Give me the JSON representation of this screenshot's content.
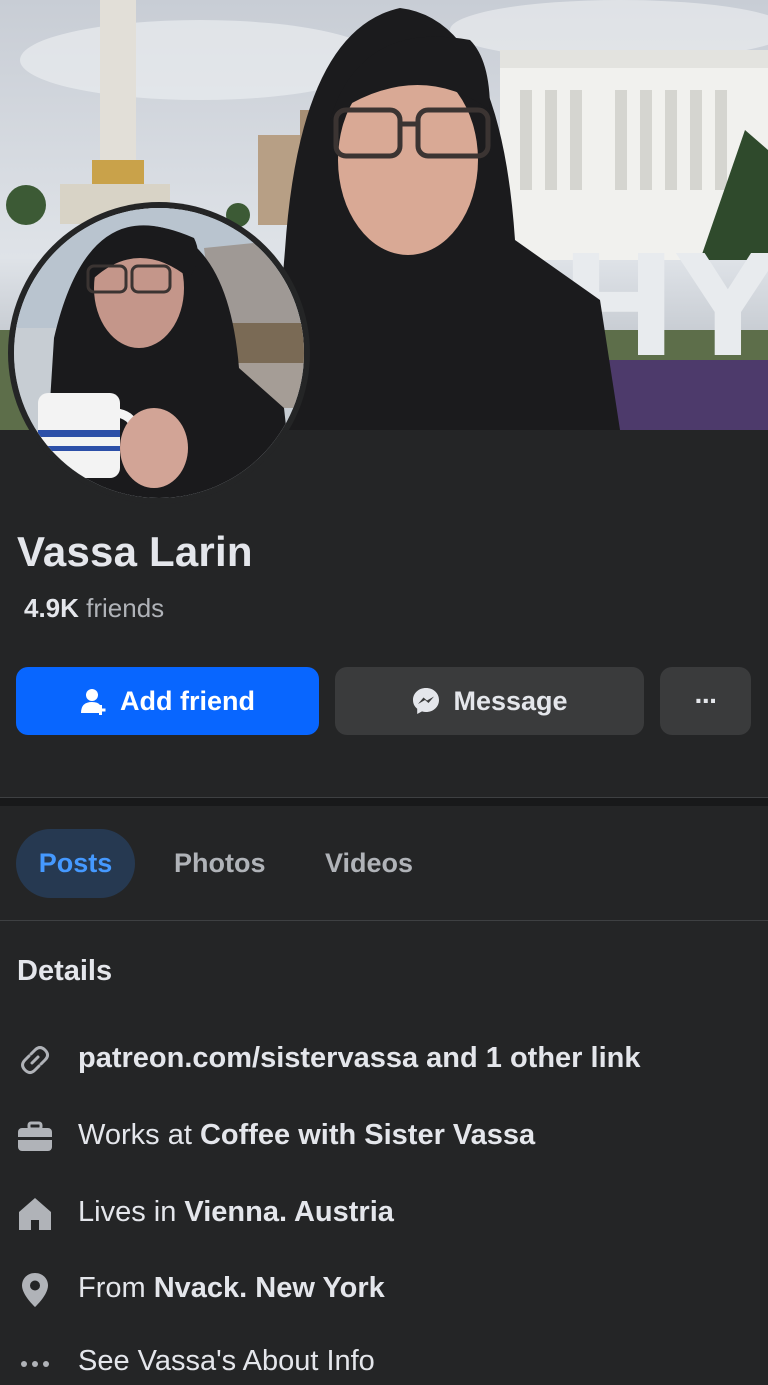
{
  "profile": {
    "name": "Vassa Larin",
    "friends_count": "4.9K",
    "friends_label": " friends"
  },
  "actions": {
    "add_friend": "Add friend",
    "message": "Message",
    "more": "···"
  },
  "tabs": [
    {
      "label": "Posts",
      "active": true
    },
    {
      "label": "Photos",
      "active": false
    },
    {
      "label": "Videos",
      "active": false
    }
  ],
  "details": {
    "title": "Details",
    "link": "patreon.com/sistervassa and 1 other link",
    "work_prefix": "Works at ",
    "work_value": "Coffee with Sister Vassa",
    "lives_prefix": "Lives in ",
    "lives_value": "Vienna. Austria",
    "from_prefix": "From ",
    "from_value": "Nvack. New York",
    "about": "See Vassa's About Info"
  },
  "cover_sign_text": "HY",
  "colors": {
    "background": "#242526",
    "primary_button": "#0866ff",
    "secondary_button": "#3a3b3c",
    "active_tab_bg": "#263951",
    "active_tab_text": "#4599ff",
    "muted_text": "#b0b3b8"
  },
  "icons": {
    "add_friend": "person-plus-icon",
    "message": "messenger-icon",
    "link": "link-icon",
    "work": "briefcase-icon",
    "home": "home-icon",
    "location": "location-pin-icon",
    "more": "ellipsis-icon"
  }
}
